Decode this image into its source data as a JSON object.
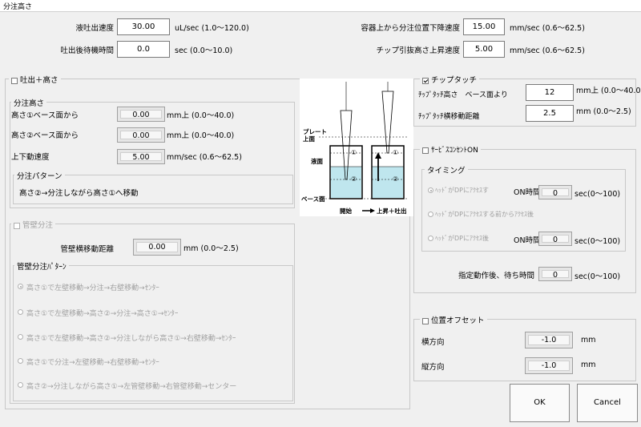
{
  "window": {
    "title": "分注高さ"
  },
  "top": {
    "discharge_speed": {
      "label": "液吐出速度",
      "value": "30.00",
      "range": "uL/sec (1.0〜120.0)"
    },
    "post_wait": {
      "label": "吐出後待機時間",
      "value": "0.0",
      "range": "sec (0.0〜10.0)"
    },
    "descent_speed": {
      "label": "容器上から分注位置下降速度",
      "value": "15.00",
      "range": "mm/sec (0.6〜62.5)"
    },
    "tip_raise_speed": {
      "label": "チップ引抜高さ上昇速度",
      "value": "5.00",
      "range": "mm/sec (0.6〜62.5)"
    }
  },
  "dispense_height": {
    "title": "吐出＋高さ",
    "subgroup_title": "分注高さ",
    "height1": {
      "label": "高さ①ベース面から",
      "value": "0.00",
      "unit": "mm上 (0.0〜40.0)"
    },
    "height2": {
      "label": "高さ②ベース面から",
      "value": "0.00",
      "unit": "mm上 (0.0〜40.0)"
    },
    "updown_speed": {
      "label": "上下動速度",
      "value": "5.00",
      "unit": "mm/sec (0.6〜62.5)"
    },
    "pattern_title": "分注パターン",
    "pattern_text": "高さ②→分注しながら高さ①へ移動"
  },
  "wall_dispense": {
    "title": "管壁分注",
    "distance": {
      "label": "管壁横移動距離",
      "value": "0.00",
      "unit": "mm (0.0〜2.5)"
    },
    "pattern_title": "管壁分注ﾊﾟﾀｰﾝ",
    "options": [
      "高さ①で左壁移動→分注→右壁移動→ｾﾝﾀｰ",
      "高さ①で左壁移動→高さ②→分注→高さ①→ｾﾝﾀｰ",
      "高さ①で左壁移動→高さ②→分注しながら高さ①→右壁移動→ｾﾝﾀｰ",
      "高さ①で分注→左壁移動→右壁移動→ｾﾝﾀｰ",
      "高さ②→分注しながら高さ①→左管壁移動→右管壁移動→センター"
    ]
  },
  "diagram": {
    "plate_top": "プレート\n上面",
    "liquid_surface": "液面",
    "base_surface": "ベース面",
    "start": "開始",
    "arrow": "上昇＋吐出",
    "mark1": "①",
    "mark2": "②"
  },
  "tip_touch": {
    "title": "チップタッチ",
    "height": {
      "label": "ﾁｯﾌﾟﾀｯﾁ高さ　ベース面より",
      "value": "12",
      "unit": "mm上 (0.0〜40.0)"
    },
    "distance": {
      "label": "ﾁｯﾌﾟﾀｯﾁ横移動距離",
      "value": "2.5",
      "unit": "mm (0.0〜2.5)"
    }
  },
  "service_outlet": {
    "title": "ｻｰﾋﾞｽｺﾝｾﾝﾄON",
    "timing_title": "タイミング",
    "opt1": "ﾍｯﾄﾞがDPにｱｸｾｽす",
    "opt2": "ﾍｯﾄﾞがDPにｱｸｾｽする前からｱｸｾｽ後",
    "opt3": "ﾍｯﾄﾞがDPにｱｸｾｽ後",
    "on_time_label": "ON時間",
    "on_time1": "0",
    "on_time2": "0",
    "on_unit": "sec(0〜100)",
    "wait_label": "指定動作後、待ち時間",
    "wait_value": "0",
    "wait_unit": "sec(0〜100)"
  },
  "position_offset": {
    "title": "位置オフセット",
    "horizontal": {
      "label": "横方向",
      "value": "-1.0",
      "unit": "mm"
    },
    "vertical": {
      "label": "縦方向",
      "value": "-1.0",
      "unit": "mm"
    }
  },
  "buttons": {
    "ok": "OK",
    "cancel": "Cancel"
  }
}
